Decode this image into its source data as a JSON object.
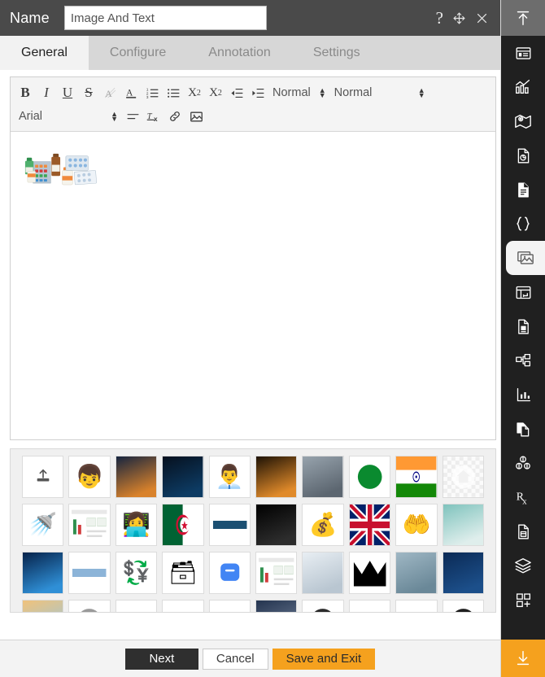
{
  "titlebar": {
    "label": "Name",
    "name_value": "Image And Text",
    "help_icon": "?",
    "move_icon": "move-icon",
    "close_icon": "close-icon"
  },
  "tabs": [
    {
      "label": "General",
      "active": true
    },
    {
      "label": "Configure",
      "active": false
    },
    {
      "label": "Annotation",
      "active": false
    },
    {
      "label": "Settings",
      "active": false
    }
  ],
  "toolbar": {
    "row1": [
      {
        "name": "bold-button",
        "label": "B"
      },
      {
        "name": "italic-button",
        "label": "I"
      },
      {
        "name": "underline-button",
        "label": "U"
      },
      {
        "name": "strikethrough-button",
        "label": "S"
      },
      {
        "name": "highlight-color-button",
        "label": "A"
      },
      {
        "name": "font-color-button",
        "label": "A"
      },
      {
        "name": "ordered-list-button",
        "label": ""
      },
      {
        "name": "unordered-list-button",
        "label": ""
      },
      {
        "name": "subscript-button",
        "label": "X"
      },
      {
        "name": "superscript-button",
        "label": "X"
      },
      {
        "name": "outdent-button",
        "label": ""
      },
      {
        "name": "indent-button",
        "label": ""
      }
    ],
    "heading_select": "Normal",
    "size_select": "Normal",
    "font_select": "Arial",
    "row2": [
      {
        "name": "align-button",
        "label": ""
      },
      {
        "name": "clear-format-button",
        "label": "Tx"
      },
      {
        "name": "insert-link-button",
        "label": ""
      },
      {
        "name": "insert-image-button",
        "label": ""
      }
    ]
  },
  "canvas": {
    "image_alt": "pharmaceutical-medicines-image"
  },
  "gallery": {
    "items": [
      {
        "name": "upload-tile",
        "kind": "upload"
      },
      {
        "name": "avatar-person-thumbnail",
        "kind": "emoji",
        "glyph": "👦"
      },
      {
        "name": "power-lines-sunset-thumbnail",
        "kind": "grad",
        "colors": [
          "#15243f",
          "#d9822b"
        ]
      },
      {
        "name": "ai-brain-thumbnail",
        "kind": "grad",
        "colors": [
          "#06101e",
          "#0d3b63"
        ]
      },
      {
        "name": "technician-server-thumbnail",
        "kind": "emoji",
        "glyph": "👨‍💼"
      },
      {
        "name": "city-skyline-thumbnail",
        "kind": "grad",
        "colors": [
          "#1d1205",
          "#e08a2a"
        ]
      },
      {
        "name": "industrial-plant-thumbnail",
        "kind": "grad",
        "colors": [
          "#97a3ad",
          "#5c6670"
        ]
      },
      {
        "name": "green-leaf-logo-thumbnail",
        "kind": "circle",
        "color": "#0a8a2f"
      },
      {
        "name": "india-flag-thumbnail",
        "kind": "flag-in"
      },
      {
        "name": "house-watermark-thumbnail",
        "kind": "checker"
      },
      {
        "name": "water-tap-thumbnail",
        "kind": "emoji",
        "glyph": "🚿"
      },
      {
        "name": "dashboard-screenshot-thumbnail",
        "kind": "doc"
      },
      {
        "name": "support-agent-thumbnail",
        "kind": "emoji",
        "glyph": "👩‍💻"
      },
      {
        "name": "algeria-flag-thumbnail",
        "kind": "flag-dz"
      },
      {
        "name": "blue-bar-thumbnail",
        "kind": "bar",
        "color": "#1b4f72"
      },
      {
        "name": "light-bulb-dark-thumbnail",
        "kind": "grad",
        "colors": [
          "#000000",
          "#2d2d2d"
        ]
      },
      {
        "name": "money-bag-thumbnail",
        "kind": "emoji",
        "glyph": "💰"
      },
      {
        "name": "uk-flag-thumbnail",
        "kind": "flag-uk"
      },
      {
        "name": "dollar-hand-thumbnail",
        "kind": "emoji",
        "glyph": "🤲"
      },
      {
        "name": "harbor-ships-thumbnail",
        "kind": "grad",
        "colors": [
          "#7fc3bd",
          "#dfeeec"
        ]
      },
      {
        "name": "blue-globe-network-thumbnail",
        "kind": "grad",
        "colors": [
          "#06224a",
          "#2f8fd6"
        ]
      },
      {
        "name": "plain-blue-thumbnail",
        "kind": "bar",
        "color": "#8cb4d8"
      },
      {
        "name": "money-cycle-thumbnail",
        "kind": "emoji",
        "glyph": "💱"
      },
      {
        "name": "binary-canister-thumbnail",
        "kind": "emoji",
        "glyph": "🗃"
      },
      {
        "name": "chat-app-icon-thumbnail",
        "kind": "rounded",
        "color": "#4285f4"
      },
      {
        "name": "blank-document-thumbnail",
        "kind": "doc"
      },
      {
        "name": "lab-scientists-thumbnail",
        "kind": "grad",
        "colors": [
          "#e8eef3",
          "#b9c6d1"
        ]
      },
      {
        "name": "black-crown-thumbnail",
        "kind": "crown"
      },
      {
        "name": "medical-supplies-thumbnail",
        "kind": "grad",
        "colors": [
          "#9fb7c4",
          "#6a8898"
        ]
      },
      {
        "name": "city-night-blue-thumbnail",
        "kind": "grad",
        "colors": [
          "#0b2a55",
          "#1c4f8a"
        ]
      },
      {
        "name": "sunrise-beach-thumbnail",
        "kind": "grad",
        "colors": [
          "#f0c27b",
          "#9ec7d8"
        ]
      },
      {
        "name": "gray-badge-thumbnail",
        "kind": "circle",
        "color": "#9a9a9a"
      },
      {
        "name": "orange-gauge-thumbnail",
        "kind": "arc",
        "color": "#f5a11e"
      },
      {
        "name": "white-card-thumbnail",
        "kind": "bar",
        "color": "#e6e6e6"
      },
      {
        "name": "white-paper-fold-thumbnail",
        "kind": "bar",
        "color": "#f5f5f5"
      },
      {
        "name": "night-mountain-thumbnail",
        "kind": "grad",
        "colors": [
          "#24344f",
          "#6b7a93"
        ]
      },
      {
        "name": "black-dot-thumbnail",
        "kind": "circle",
        "color": "#2b2b2b"
      },
      {
        "name": "light-gray-thumbnail",
        "kind": "bar",
        "color": "#dddddd"
      },
      {
        "name": "red-line-thumbnail",
        "kind": "bar",
        "color": "#e0123c"
      },
      {
        "name": "dark-face-icon-thumbnail",
        "kind": "circle",
        "color": "#1f1f1f"
      }
    ]
  },
  "footer": {
    "next_label": "Next",
    "cancel_label": "Cancel",
    "save_label": "Save and Exit"
  },
  "sidebar": {
    "items": [
      {
        "name": "collapse-panel-button",
        "icon": "arrow-up-bar-icon",
        "state": "header"
      },
      {
        "name": "sidebar-item-form",
        "icon": "form-layout-icon",
        "state": "normal"
      },
      {
        "name": "sidebar-item-analytics",
        "icon": "bar-line-chart-icon",
        "state": "normal"
      },
      {
        "name": "sidebar-item-map",
        "icon": "map-pin-icon",
        "state": "normal"
      },
      {
        "name": "sidebar-item-report-chart",
        "icon": "document-piechart-icon",
        "state": "normal"
      },
      {
        "name": "sidebar-item-document",
        "icon": "document-lines-icon",
        "state": "normal"
      },
      {
        "name": "sidebar-item-code",
        "icon": "curly-braces-icon",
        "state": "normal"
      },
      {
        "name": "sidebar-item-image-and-text",
        "icon": "image-gallery-icon",
        "state": "active"
      },
      {
        "name": "sidebar-item-layout-template",
        "icon": "layout-template-icon",
        "state": "normal"
      },
      {
        "name": "sidebar-item-file-note",
        "icon": "document-note-icon",
        "state": "normal"
      },
      {
        "name": "sidebar-item-hierarchy",
        "icon": "tree-structure-icon",
        "state": "normal"
      },
      {
        "name": "sidebar-item-statistics",
        "icon": "chart-axis-icon",
        "state": "normal"
      },
      {
        "name": "sidebar-item-copy-document",
        "icon": "duplicate-document-icon",
        "state": "normal"
      },
      {
        "name": "sidebar-item-modules",
        "icon": "cubes-icon",
        "state": "normal"
      },
      {
        "name": "sidebar-item-prescription",
        "icon": "rx-icon",
        "state": "normal"
      },
      {
        "name": "sidebar-item-saved-document",
        "icon": "document-save-icon",
        "state": "normal"
      },
      {
        "name": "sidebar-item-layers",
        "icon": "layers-icon",
        "state": "normal"
      },
      {
        "name": "sidebar-item-add-widget",
        "icon": "grid-plus-icon",
        "state": "normal"
      },
      {
        "name": "sidebar-download-button",
        "icon": "download-icon",
        "state": "footer"
      }
    ]
  }
}
